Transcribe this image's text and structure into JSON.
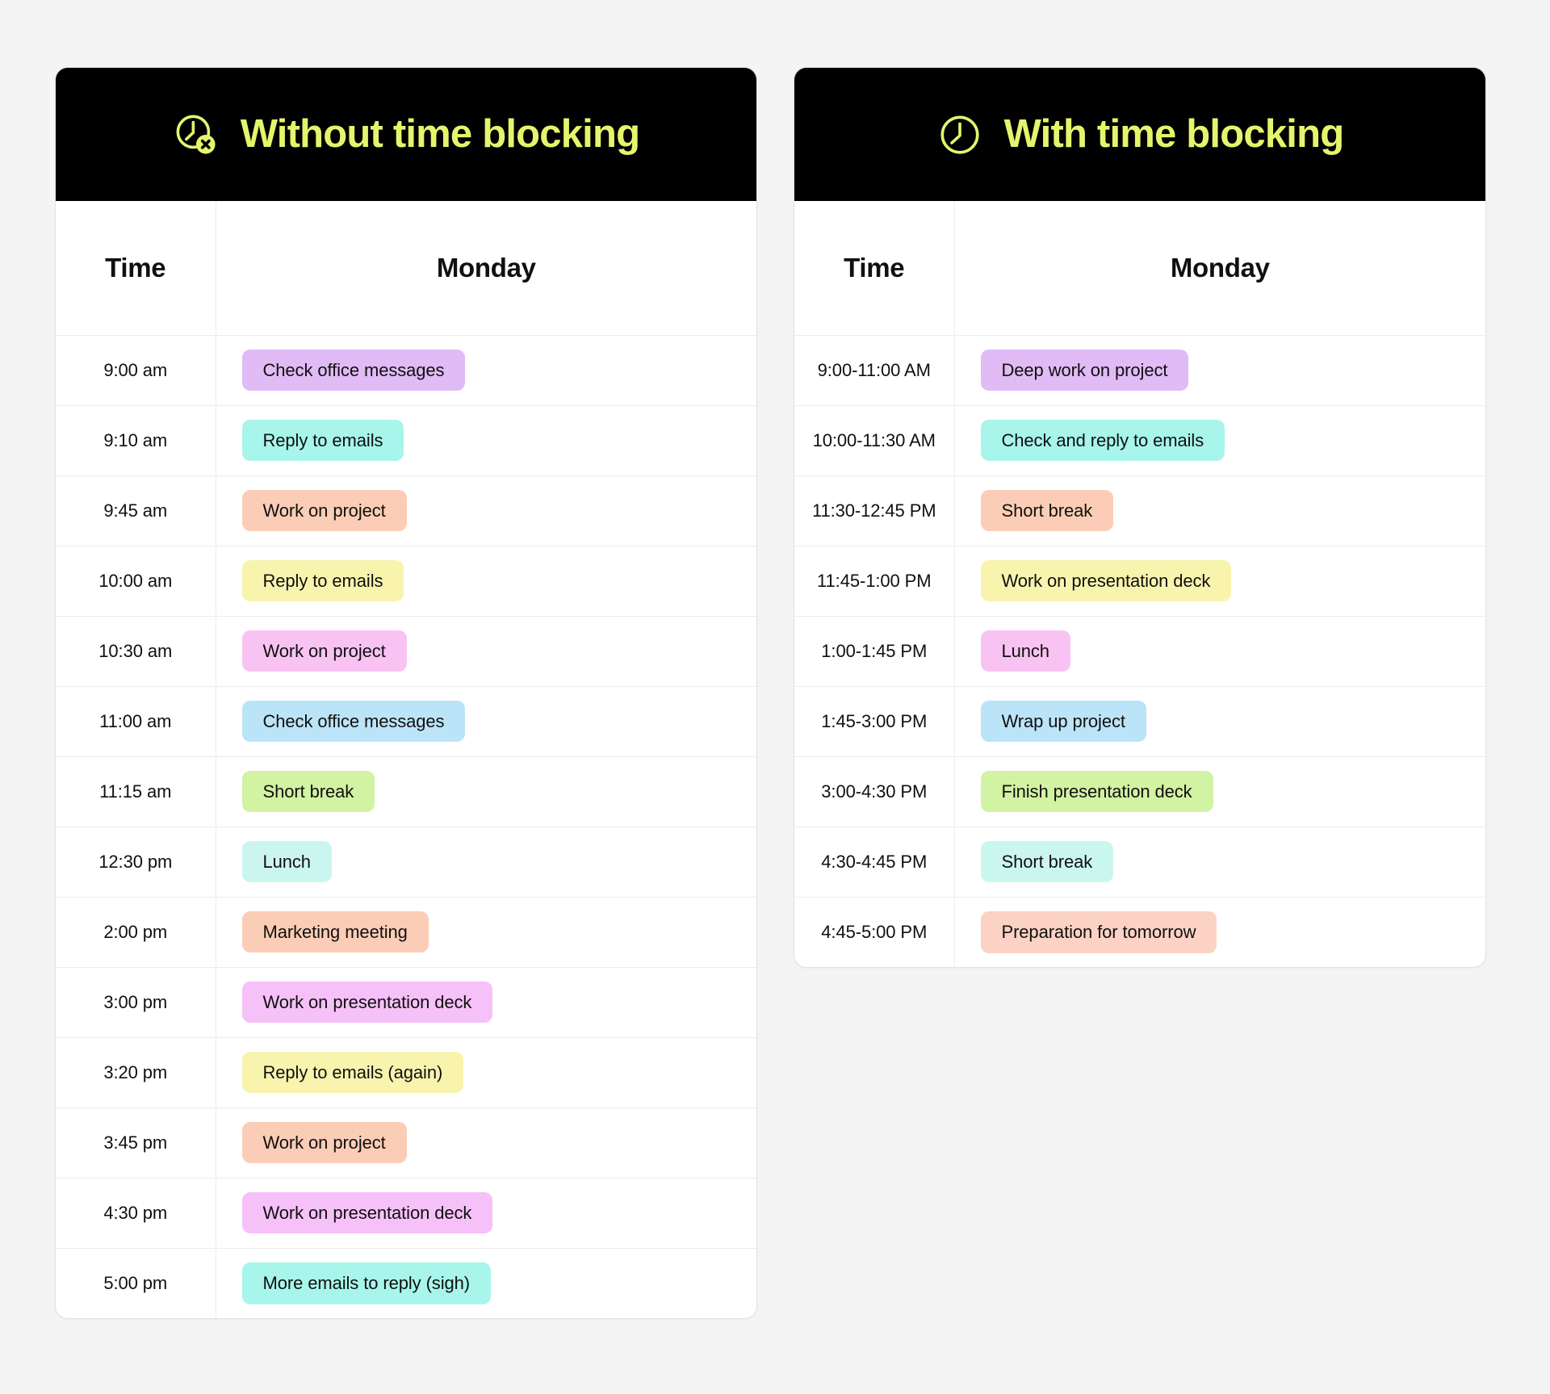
{
  "page": {
    "background_color": "#F4F4F4",
    "accent_color": "#E4F56C",
    "header_background": "#000000"
  },
  "palette": {
    "lavender": "#E0BBF5",
    "aqua": "#A7F5EB",
    "peach": "#FBCDB6",
    "yellow": "#F8F4AE",
    "pink": "#F8C3F2",
    "blue": "#BCE4F8",
    "green": "#D2F2A4",
    "pale_cyan": "#CBF6F0",
    "magenta": "#F6C0F8",
    "light_peach": "#FBD2C4"
  },
  "columns": {
    "time": "Time",
    "day": "Monday"
  },
  "cards": [
    {
      "id": "without-time-blocking",
      "title": "Without time blocking",
      "icon": "clock-x-icon",
      "rows": [
        {
          "time": "9:00 am",
          "task": "Check office messages",
          "color": "#E0BBF5"
        },
        {
          "time": "9:10 am",
          "task": "Reply to emails",
          "color": "#A7F5EB"
        },
        {
          "time": "9:45 am",
          "task": "Work on project",
          "color": "#FBCDB6"
        },
        {
          "time": "10:00 am",
          "task": "Reply to emails",
          "color": "#F8F4AE"
        },
        {
          "time": "10:30 am",
          "task": "Work on project",
          "color": "#F8C3F2"
        },
        {
          "time": "11:00 am",
          "task": "Check office messages",
          "color": "#BCE4F8"
        },
        {
          "time": "11:15 am",
          "task": "Short break",
          "color": "#D2F2A4"
        },
        {
          "time": "12:30 pm",
          "task": "Lunch",
          "color": "#CBF6F0"
        },
        {
          "time": "2:00 pm",
          "task": "Marketing meeting",
          "color": "#FBCDB6"
        },
        {
          "time": "3:00 pm",
          "task": "Work on presentation deck",
          "color": "#F6C0F8"
        },
        {
          "time": "3:20 pm",
          "task": "Reply to emails (again)",
          "color": "#F8F4AE"
        },
        {
          "time": "3:45 pm",
          "task": "Work on project",
          "color": "#FBCDB6"
        },
        {
          "time": "4:30 pm",
          "task": "Work on presentation deck",
          "color": "#F6C0F8"
        },
        {
          "time": "5:00 pm",
          "task": "More emails to reply (sigh)",
          "color": "#A7F5EB"
        }
      ]
    },
    {
      "id": "with-time-blocking",
      "title": "With time blocking",
      "icon": "clock-icon",
      "rows": [
        {
          "time": "9:00-11:00 AM",
          "task": "Deep work on project",
          "color": "#E0BBF5"
        },
        {
          "time": "10:00-11:30 AM",
          "task": "Check and reply to emails",
          "color": "#A7F5EB"
        },
        {
          "time": "11:30-12:45 PM",
          "task": "Short break",
          "color": "#FBCDB6"
        },
        {
          "time": "11:45-1:00 PM",
          "task": "Work on presentation deck",
          "color": "#F8F4AE"
        },
        {
          "time": "1:00-1:45 PM",
          "task": "Lunch",
          "color": "#F8C3F2"
        },
        {
          "time": "1:45-3:00 PM",
          "task": "Wrap up project",
          "color": "#BCE4F8"
        },
        {
          "time": "3:00-4:30 PM",
          "task": "Finish presentation deck",
          "color": "#D2F2A4"
        },
        {
          "time": "4:30-4:45 PM",
          "task": "Short break",
          "color": "#CBF6F0"
        },
        {
          "time": "4:45-5:00 PM",
          "task": "Preparation for tomorrow",
          "color": "#FBD2C4"
        }
      ]
    }
  ]
}
